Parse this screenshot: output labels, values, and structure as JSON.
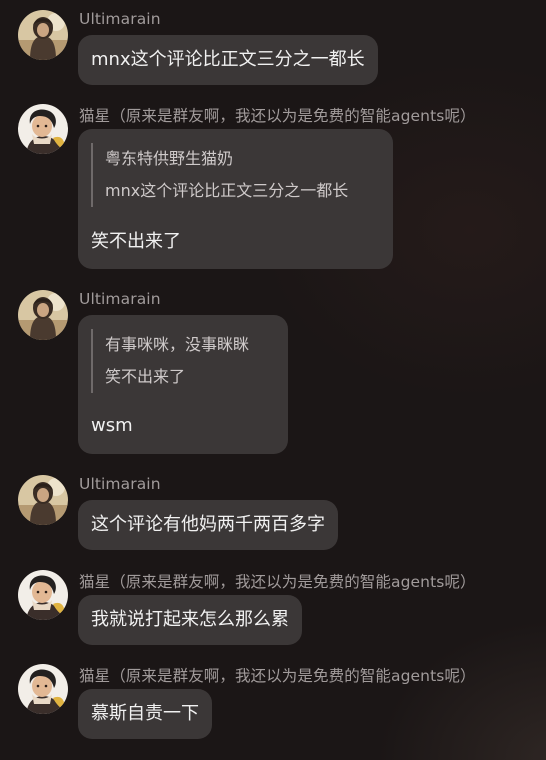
{
  "messages": [
    {
      "sender": "Ultimarain",
      "avatar": "ultimarain-avatar",
      "text": "mnx这个评论比正文三分之一都长"
    },
    {
      "sender": "猫星（原来是群友啊，我还以为是免费的智能agents呢）",
      "avatar": "maoxing-avatar",
      "quote": [
        "粤东特供野生猫奶",
        "mnx这个评论比正文三分之一都长"
      ],
      "text": "笑不出来了"
    },
    {
      "sender": "Ultimarain",
      "avatar": "ultimarain-avatar",
      "quote": [
        "有事咪咪，没事眯眯",
        "笑不出来了"
      ],
      "text": "wsm"
    },
    {
      "sender": "Ultimarain",
      "avatar": "ultimarain-avatar",
      "text": "这个评论有他妈两千两百多字"
    },
    {
      "sender": "猫星（原来是群友啊，我还以为是免费的智能agents呢）",
      "avatar": "maoxing-avatar",
      "text": "我就说打起来怎么那么累"
    },
    {
      "sender": "猫星（原来是群友啊，我还以为是免费的智能agents呢）",
      "avatar": "maoxing-avatar",
      "text": "慕斯自责一下"
    }
  ],
  "colors": {
    "background": "#1b1616",
    "bubble": "#3b3737",
    "sender": "#a19b9b",
    "quote_bar": "#6f6a6a"
  }
}
